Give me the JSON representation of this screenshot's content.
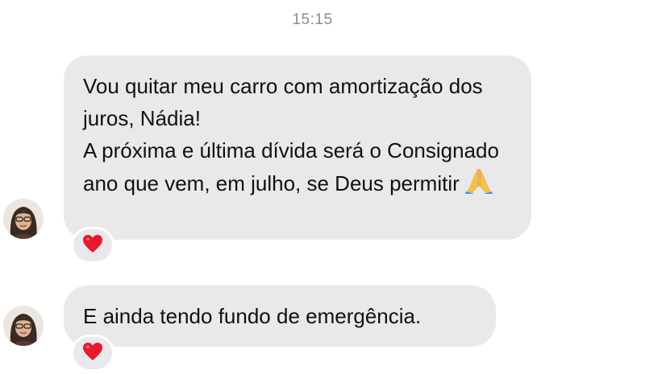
{
  "timestamp": "15:15",
  "messages": [
    {
      "lines": [
        "Vou quitar meu carro com amortização dos juros, Nádia!",
        "A próxima e última dívida será o Consignado ano que vem, em julho, se Deus permitir"
      ],
      "emoji": "folded-hands",
      "reaction": "red-heart"
    },
    {
      "lines": [
        "E ainda tendo fundo de emergência."
      ],
      "reaction": "red-heart"
    }
  ],
  "colors": {
    "bubble": "#e9e9eb",
    "timestamp": "#8e8e93",
    "heart": "#e8182d"
  }
}
